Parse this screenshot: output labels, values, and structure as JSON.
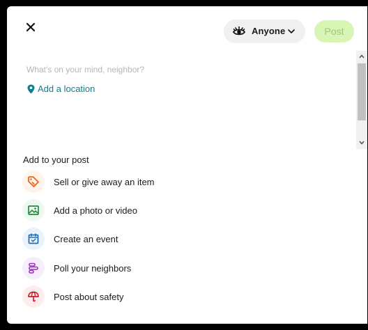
{
  "header": {
    "close_icon": "close-icon",
    "audience": {
      "label": "Anyone",
      "icon": "eye-icon",
      "chevron": "chevron-down-icon"
    },
    "post_label": "Post"
  },
  "composer": {
    "placeholder": "What's on your mind, neighbor?",
    "value": "",
    "add_location_label": "Add a location",
    "add_location_icon": "map-pin-icon"
  },
  "add_to_post": {
    "title": "Add to your post",
    "options": [
      {
        "label": "Sell or give away an item",
        "icon": "tag-icon",
        "color": "#e8651f"
      },
      {
        "label": "Add a photo or video",
        "icon": "photo-icon",
        "color": "#1f8f3a"
      },
      {
        "label": "Create an event",
        "icon": "calendar-icon",
        "color": "#1f6fb8"
      },
      {
        "label": "Poll your neighbors",
        "icon": "poll-icon",
        "color": "#a230c7"
      },
      {
        "label": "Post about safety",
        "icon": "umbrella-icon",
        "color": "#d11a2a"
      }
    ]
  },
  "colors": {
    "post_button_bg": "#d7f5b5",
    "post_button_text": "#9bcb76",
    "link_teal": "#0f7f8a",
    "pill_bg": "#eef0f1"
  }
}
